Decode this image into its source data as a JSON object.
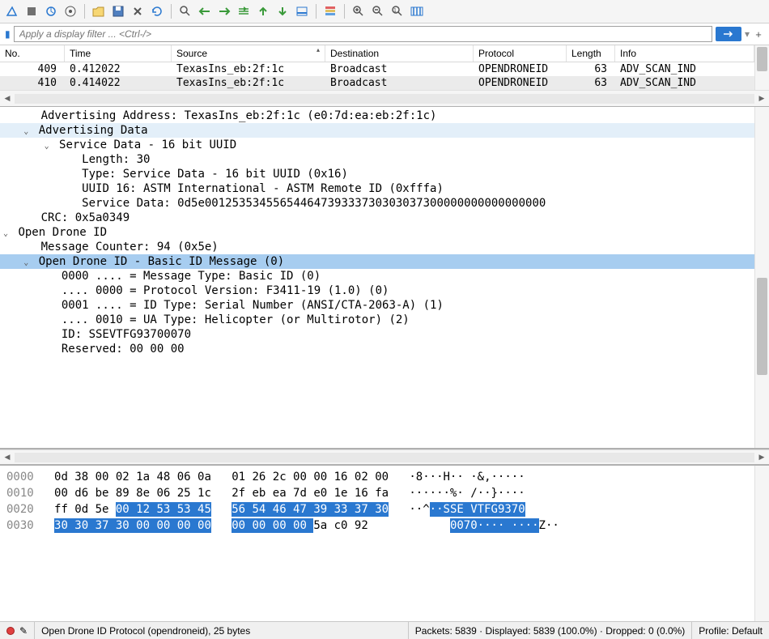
{
  "filter": {
    "placeholder": "Apply a display filter ... <Ctrl-/>"
  },
  "packet_list": {
    "headers": [
      "No.",
      "Time",
      "Source",
      "Destination",
      "Protocol",
      "Length",
      "Info"
    ],
    "rows": [
      {
        "no": "409",
        "time": "0.412022",
        "src": "TexasIns_eb:2f:1c",
        "dst": "Broadcast",
        "proto": "OPENDRONEID",
        "len": "63",
        "info": "ADV_SCAN_IND"
      },
      {
        "no": "410",
        "time": "0.414022",
        "src": "TexasIns_eb:2f:1c",
        "dst": "Broadcast",
        "proto": "OPENDRONEID",
        "len": "63",
        "info": "ADV_SCAN_IND"
      }
    ]
  },
  "tree": {
    "adv_addr": "Advertising Address: TexasIns_eb:2f:1c (e0:7d:ea:eb:2f:1c)",
    "adv_data": "Advertising Data",
    "svc_data_h": "Service Data - 16 bit UUID",
    "length": "Length: 30",
    "type": "Type: Service Data - 16 bit UUID (0x16)",
    "uuid": "UUID 16: ASTM International - ASTM Remote ID (0xfffa)",
    "svc_data": "Service Data: 0d5e00125353455654464739333730303037300000000000000000",
    "crc": "CRC: 0x5a0349",
    "odid": "Open Drone ID",
    "msg_ctr": "Message Counter: 94 (0x5e)",
    "basic_id": "Open Drone ID - Basic ID Message (0)",
    "mt": "0000 .... = Message Type: Basic ID (0)",
    "pv": ".... 0000 = Protocol Version: F3411-19 (1.0) (0)",
    "idt": "0001 .... = ID Type: Serial Number (ANSI/CTA-2063-A) (1)",
    "uat": ".... 0010 = UA Type: Helicopter (or Multirotor) (2)",
    "id": "ID: SSEVTFG93700070",
    "reserved": "Reserved: 00 00 00"
  },
  "hex": {
    "lines": [
      {
        "off": "0000",
        "b1": "0d 38 00 02 1a 48 06 0a",
        "b2": "01 26 2c 00 00 16 02 00",
        "a": "·8···H·· ·&,·····"
      },
      {
        "off": "0010",
        "b1": "00 d6 be 89 8e 06 25 1c",
        "b2": "2f eb ea 7d e0 1e 16 fa",
        "a": "······%· /··}····"
      },
      {
        "off": "0020",
        "b1p": "ff 0d 5e ",
        "b1s": "00 12 53 53 45",
        "b2s": "56 54 46 47 39 33 37 30",
        "ap": "··^",
        "as": "··SSE VTFG9370"
      },
      {
        "off": "0030",
        "b1s": "30 30 37 30 00 00 00 00",
        "b2s": "00 00 00 00 ",
        "b2p": "5a c0 92",
        "as": "0070···· ····",
        "ap": "Z··"
      }
    ]
  },
  "status": {
    "proto": "Open Drone ID Protocol (opendroneid), 25 bytes",
    "pkts": "Packets: 5839 · Displayed: 5839 (100.0%) · Dropped: 0 (0.0%)",
    "profile": "Profile: Default"
  }
}
